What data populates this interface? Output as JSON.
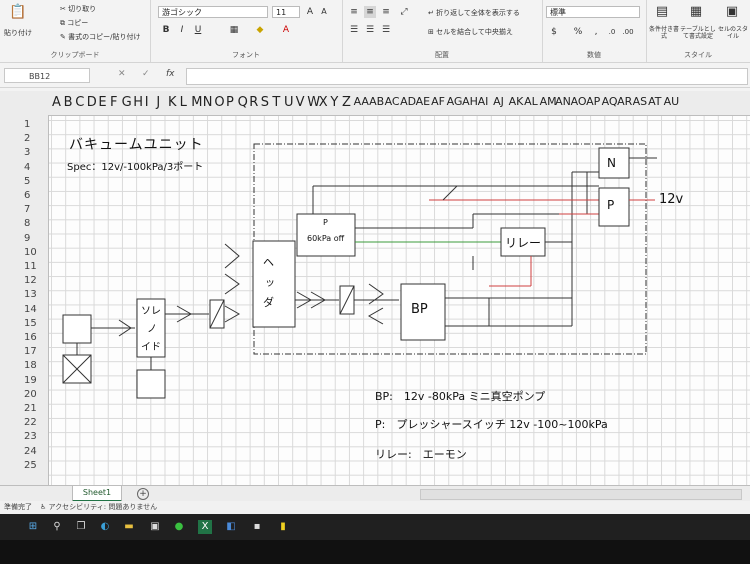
{
  "ribbon": {
    "clipboard": {
      "paste": "貼り付け",
      "cut": "切り取り",
      "copy": "コピー",
      "format_painter": "書式のコピー/貼り付け",
      "label": "クリップボード"
    },
    "font": {
      "name": "游ゴシック",
      "size": "11",
      "label": "フォント"
    },
    "alignment": {
      "wrap": "折り返して全体を表示する",
      "merge": "セルを結合して中央揃え",
      "label": "配置"
    },
    "number": {
      "format": "標準",
      "label": "数値"
    },
    "styles": {
      "conditional": "条件付き書式",
      "table": "テーブルとして書式設定",
      "cell": "セルのスタイル",
      "label": "スタイル"
    }
  },
  "formula_bar": {
    "name_box": "BB12",
    "fx": "fx",
    "content": ""
  },
  "columns": [
    "A",
    "B",
    "C",
    "D",
    "E",
    "F",
    "G",
    "H",
    "I",
    "J",
    "K",
    "L",
    "M",
    "N",
    "O",
    "P",
    "Q",
    "R",
    "S",
    "T",
    "U",
    "V",
    "W",
    "X",
    "Y",
    "Z",
    "AA",
    "AB",
    "AC",
    "AD",
    "AE",
    "AF",
    "AG",
    "AH",
    "AI",
    "AJ",
    "AK",
    "AL",
    "AM",
    "AN",
    "AO",
    "AP",
    "AQ",
    "AR",
    "AS",
    "AT",
    "AU"
  ],
  "rows": [
    "1",
    "2",
    "3",
    "4",
    "5",
    "6",
    "7",
    "8",
    "9",
    "10",
    "11",
    "12",
    "13",
    "14",
    "15",
    "16",
    "17",
    "18",
    "19",
    "20",
    "21",
    "22",
    "23",
    "24",
    "25"
  ],
  "diagram": {
    "title": "バキュームユニット",
    "spec": "Spec：12v/-100kPa/3ポート",
    "solenoid": [
      "ソレ",
      "ノ",
      "イド"
    ],
    "header_box": [
      "ヘ",
      "ッ",
      "ダ"
    ],
    "pressure_switch": [
      "P",
      "60kPa off"
    ],
    "relay": "リレー",
    "pump": "BP",
    "power_n": "N",
    "power_p": "P",
    "voltage": "12v",
    "legend": [
      "BP:　12v -80kPa ミニ真空ポンプ",
      "P:　プレッシャースイッチ 12v -100~100kPa",
      "リレー:　エーモン"
    ]
  },
  "sheet_tab": "Sheet1",
  "status": {
    "ready": "準備完了",
    "accessibility": "アクセシビリティ: 問題ありません"
  },
  "colors": {
    "accent": "#217346",
    "wire_red": "#d04040",
    "wire_green": "#3a9a3a"
  }
}
